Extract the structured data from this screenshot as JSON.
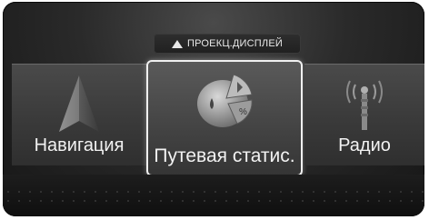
{
  "banner": {
    "label": "ПРОЕКЦ.ДИСПЛЕЙ",
    "icon": "triangle-up-icon"
  },
  "menu": {
    "items": [
      {
        "label": "Навигация",
        "icon": "navigation-arrow-icon",
        "selected": false
      },
      {
        "label": "Путевая статис.",
        "icon": "trip-statistics-icon",
        "selected": true
      },
      {
        "label": "Радио",
        "icon": "radio-antenna-icon",
        "selected": false
      }
    ]
  },
  "colors": {
    "background": "#2a2a2a",
    "tile": "#3f3f3f",
    "highlight_border": "#f0f0f0",
    "text": "#f2f2f2"
  }
}
